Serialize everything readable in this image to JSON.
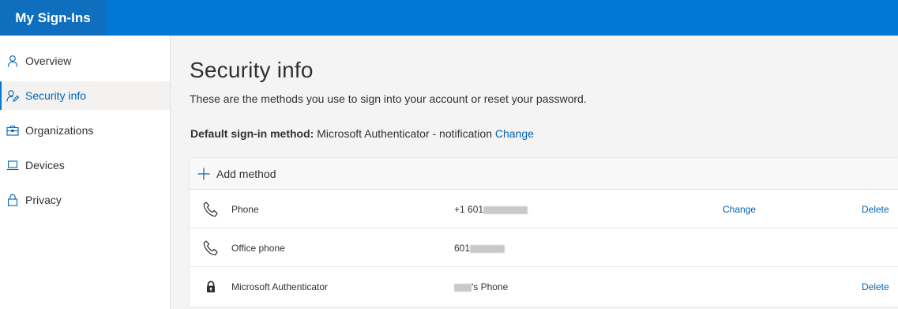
{
  "app": {
    "title": "My Sign-Ins"
  },
  "sidebar": {
    "items": [
      {
        "label": "Overview",
        "icon": "person-icon",
        "active": false
      },
      {
        "label": "Security info",
        "icon": "person-edit-icon",
        "active": true
      },
      {
        "label": "Organizations",
        "icon": "briefcase-icon",
        "active": false
      },
      {
        "label": "Devices",
        "icon": "laptop-icon",
        "active": false
      },
      {
        "label": "Privacy",
        "icon": "lock-icon",
        "active": false
      }
    ]
  },
  "main": {
    "title": "Security info",
    "subtitle": "These are the methods you use to sign into your account or reset your password.",
    "default_method": {
      "label": "Default sign-in method:",
      "value": "Microsoft Authenticator - notification",
      "change": "Change"
    },
    "add_method": "Add method",
    "methods": [
      {
        "name": "Phone",
        "icon": "phone-icon",
        "detail_prefix": "+1 601",
        "detail_suffix": "",
        "change": "Change",
        "delete": "Delete"
      },
      {
        "name": "Office phone",
        "icon": "phone-icon",
        "detail_prefix": "601",
        "detail_suffix": "",
        "change": "",
        "delete": ""
      },
      {
        "name": "Microsoft Authenticator",
        "icon": "authenticator-lock-icon",
        "detail_prefix": "",
        "detail_suffix": "'s Phone",
        "change": "",
        "delete": "Delete"
      }
    ]
  },
  "colors": {
    "topbar": "#0078d4",
    "brand": "#106ebe",
    "link": "#0063b1"
  }
}
